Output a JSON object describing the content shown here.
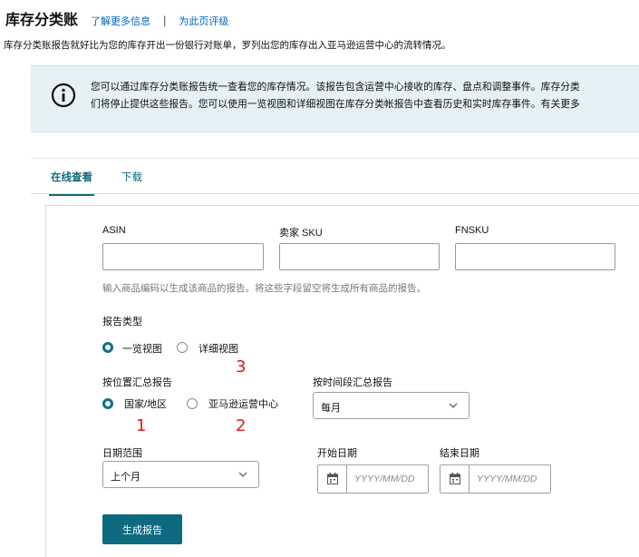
{
  "header": {
    "title": "库存分类账",
    "learn_more": "了解更多信息",
    "separator": "|",
    "rate_page": "为此页评级",
    "description": "库存分类账报告就好比为您的库存开出一份银行对账单，罗列出您的库存出入亚马逊运营中心的流转情况。"
  },
  "info_banner": {
    "line1": "您可以通过库存分类账报告统一查看您的库存情况。该报告包含运营中心接收的库存、盘点和调整事件。库存分类",
    "line2": "们将停止提供这些报告。您可以使用一览视图和详细视图在库存分类帐报告中查看历史和实时库存事件。有关更多",
    "icon": "info-icon"
  },
  "tabs": [
    {
      "label": "在线查看",
      "active": true
    },
    {
      "label": "下载",
      "active": false
    }
  ],
  "form": {
    "asin_label": "ASIN",
    "sku_label": "卖家 SKU",
    "fnsku_label": "FNSKU",
    "asin_value": "",
    "sku_value": "",
    "fnsku_value": "",
    "code_hint": "输入商品编码以生成该商品的报告。将这些字段留空将生成所有商品的报告。",
    "report_type_label": "报告类型",
    "report_type_options": [
      "一览视图",
      "详细视图"
    ],
    "report_type_selected": "一览视图",
    "location_label": "按位置汇总报告",
    "location_options": [
      "国家/地区",
      "亚马逊运营中心"
    ],
    "location_selected": "国家/地区",
    "period_label": "按时间段汇总报告",
    "period_value": "每月",
    "date_range_label": "日期范围",
    "date_range_value": "上个月",
    "start_date_label": "开始日期",
    "end_date_label": "结束日期",
    "start_date_placeholder": "YYYY/MM/DD",
    "end_date_placeholder": "YYYY/MM/DD",
    "generate_button": "生成报告"
  },
  "annotations": [
    "1",
    "2",
    "3"
  ],
  "colors": {
    "accent": "#0e6a80",
    "banner_bg": "#e5f1f5",
    "link": "#0066c0",
    "annotation": "#e0191c"
  }
}
